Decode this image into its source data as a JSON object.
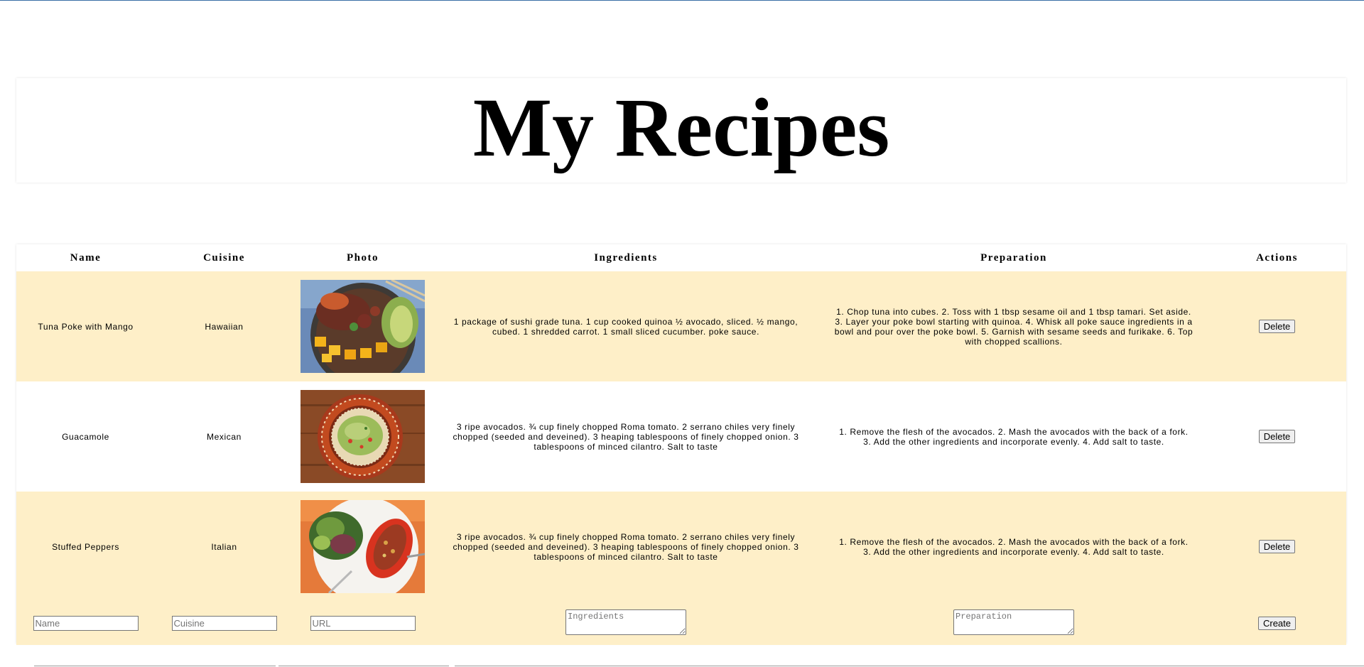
{
  "header": {
    "title": "My Recipes"
  },
  "table": {
    "columns": [
      "Name",
      "Cuisine",
      "Photo",
      "Ingredients",
      "Preparation",
      "Actions"
    ],
    "rows": [
      {
        "name": "Tuna Poke with Mango",
        "cuisine": "Hawaiian",
        "photo": "poke-bowl",
        "ingredients": "1 package of sushi grade tuna. 1 cup cooked quinoa ½ avocado, sliced. ½ mango, cubed. 1 shredded carrot. 1 small sliced cucumber. poke sauce.",
        "preparation": "1. Chop tuna into cubes. 2. Toss with 1 tbsp sesame oil and 1 tbsp tamari. Set aside. 3. Layer your poke bowl starting with quinoa. 4. Whisk all poke sauce ingredients in a bowl and pour over the poke bowl. 5. Garnish with sesame seeds and furikake. 6. Top with chopped scallions.",
        "action": "Delete"
      },
      {
        "name": "Guacamole",
        "cuisine": "Mexican",
        "photo": "guacamole-plate",
        "ingredients": "3 ripe avocados. ¾ cup finely chopped Roma tomato. 2 serrano chiles very finely chopped (seeded and deveined). 3 heaping tablespoons of finely chopped onion. 3 tablespoons of minced cilantro. Salt to taste",
        "preparation": "1. Remove the flesh of the avocados. 2. Mash the avocados with the back of a fork. 3. Add the other ingredients and incorporate evenly. 4. Add salt to taste.",
        "action": "Delete"
      },
      {
        "name": "Stuffed Peppers",
        "cuisine": "Italian",
        "photo": "stuffed-pepper-plate",
        "ingredients": "3 ripe avocados. ¾ cup finely chopped Roma tomato. 2 serrano chiles very finely chopped (seeded and deveined). 3 heaping tablespoons of finely chopped onion. 3 tablespoons of minced cilantro. Salt to taste",
        "preparation": "1. Remove the flesh of the avocados. 2. Mash the avocados with the back of a fork. 3. Add the other ingredients and incorporate evenly. 4. Add salt to taste.",
        "action": "Delete"
      }
    ]
  },
  "form": {
    "name_placeholder": "Name",
    "name_value": "",
    "cuisine_placeholder": "Cuisine",
    "cuisine_value": "",
    "url_placeholder": "URL",
    "url_value": "",
    "ingredients_placeholder": "Ingredients",
    "preparation_placeholder": "Preparation",
    "create_label": "Create"
  },
  "colors": {
    "row_highlight": "#feefc8",
    "row_plain": "#ffffff",
    "title": "#000000"
  }
}
